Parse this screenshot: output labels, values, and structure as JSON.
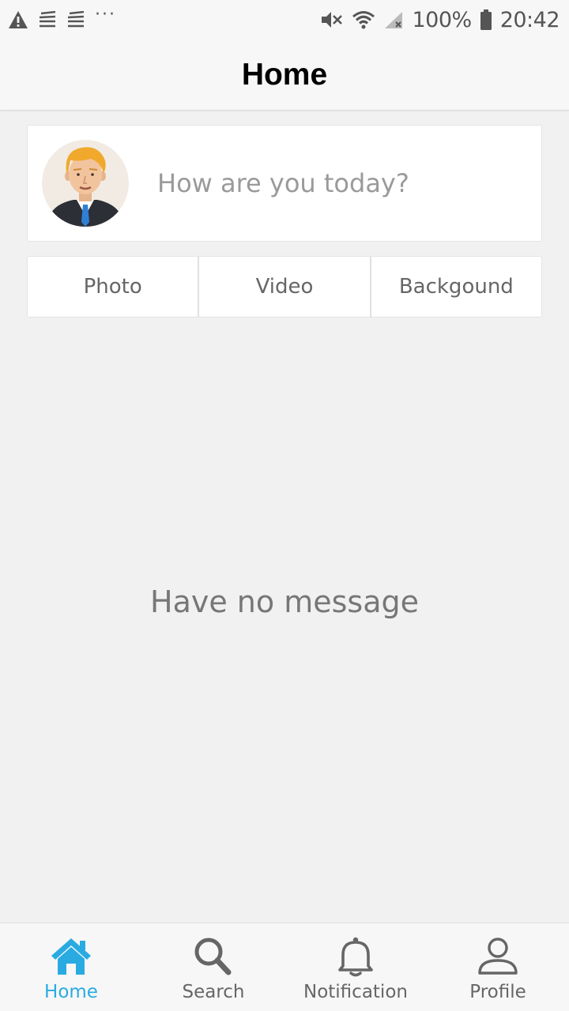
{
  "theme": {
    "accent": "#29abe2",
    "icon_gray": "#666666",
    "background": "#f1f1f1"
  },
  "status_bar": {
    "left_icons": [
      "warning-icon",
      "notification-lines-icon",
      "notification-lines-icon",
      "more-dots-icon"
    ],
    "more_dots": "···",
    "right_icons": [
      "mute-icon",
      "wifi-icon",
      "signal-icon",
      "battery-icon"
    ],
    "battery": "100%",
    "time": "20:42"
  },
  "header": {
    "title": "Home"
  },
  "composer": {
    "avatar_icon": "user-avatar",
    "placeholder": "How are you today?"
  },
  "actions": [
    {
      "label": "Photo"
    },
    {
      "label": "Video"
    },
    {
      "label": "Backgound"
    }
  ],
  "empty_state": {
    "message": "Have no message"
  },
  "bottom_nav": {
    "active": "Home",
    "items": [
      {
        "label": "Home",
        "icon": "home-icon"
      },
      {
        "label": "Search",
        "icon": "search-icon"
      },
      {
        "label": "Notification",
        "icon": "bell-icon"
      },
      {
        "label": "Profile",
        "icon": "person-icon"
      }
    ]
  }
}
